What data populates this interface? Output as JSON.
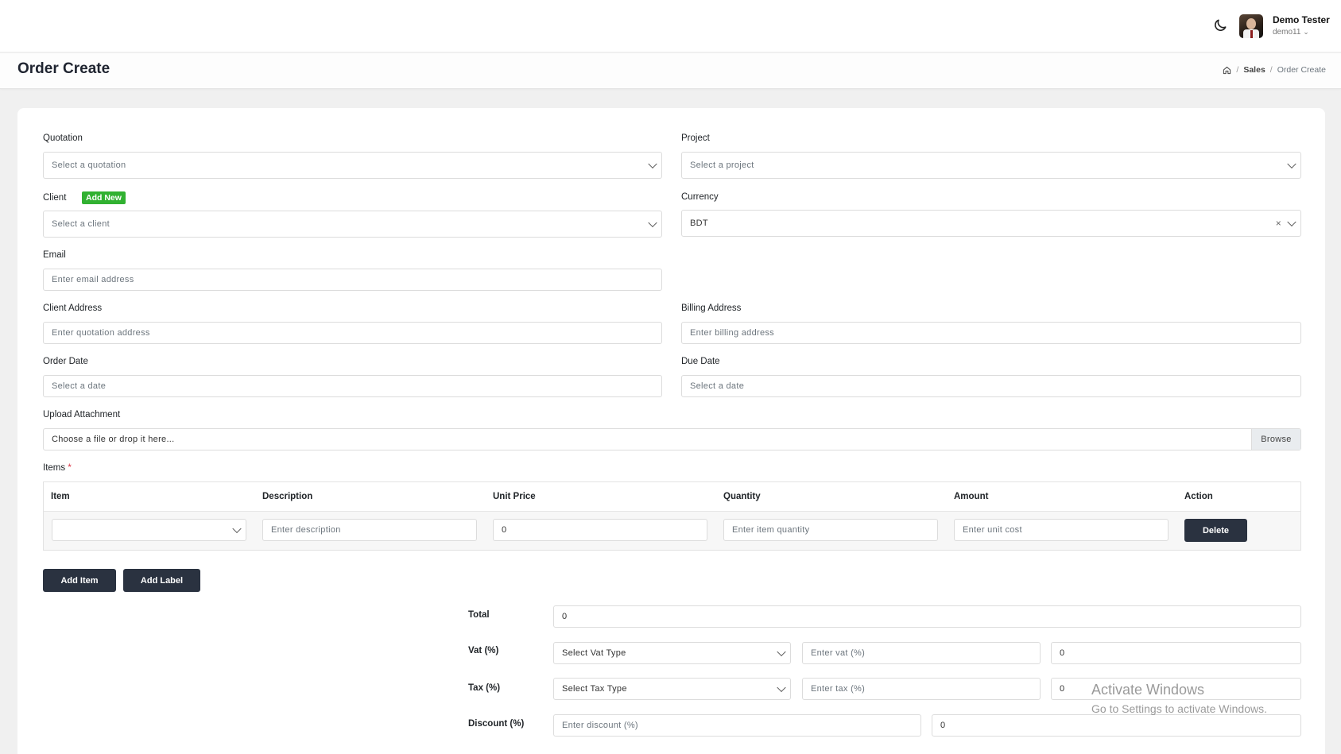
{
  "header": {
    "theme_toggle_icon": "moon-icon",
    "user_name": "Demo Tester",
    "user_id": "demo11"
  },
  "page": {
    "title": "Order Create",
    "breadcrumb": [
      "Sales",
      "Order Create"
    ]
  },
  "form": {
    "quotation": {
      "label": "Quotation",
      "placeholder": "Select a quotation"
    },
    "project": {
      "label": "Project",
      "placeholder": "Select a project"
    },
    "client": {
      "label": "Client",
      "add_new": "Add New",
      "placeholder": "Select a client"
    },
    "currency": {
      "label": "Currency",
      "value": "BDT",
      "clear": "×"
    },
    "email": {
      "label": "Email",
      "placeholder": "Enter email address"
    },
    "client_address": {
      "label": "Client Address",
      "placeholder": "Enter quotation address"
    },
    "billing_address": {
      "label": "Billing Address",
      "placeholder": "Enter billing address"
    },
    "order_date": {
      "label": "Order Date",
      "placeholder": "Select a date"
    },
    "due_date": {
      "label": "Due Date",
      "placeholder": "Select a date"
    },
    "attachment": {
      "label": "Upload Attachment",
      "placeholder": "Choose a file or drop it here...",
      "browse": "Browse"
    }
  },
  "items": {
    "label": "Items",
    "required_mark": "*",
    "columns": [
      "Item",
      "Description",
      "Unit Price",
      "Quantity",
      "Amount",
      "Action"
    ],
    "row": {
      "item": "",
      "description_placeholder": "Enter description",
      "unit_price": "0",
      "quantity_placeholder": "Enter item quantity",
      "amount_placeholder": "Enter unit cost",
      "delete": "Delete"
    },
    "add_item": "Add Item",
    "add_label": "Add Label"
  },
  "summary": {
    "total": {
      "label": "Total",
      "value": "0"
    },
    "vat": {
      "label": "Vat (%)",
      "type_placeholder": "Select Vat Type",
      "rate_placeholder": "Enter vat (%)",
      "value": "0"
    },
    "tax": {
      "label": "Tax (%)",
      "type_placeholder": "Select Tax Type",
      "rate_placeholder": "Enter tax (%)",
      "value": "0"
    },
    "discount": {
      "label": "Discount (%)",
      "rate_placeholder": "Enter discount (%)",
      "value": "0"
    }
  },
  "watermark": {
    "line1": "Activate Windows",
    "line2": "Go to Settings to activate Windows."
  }
}
